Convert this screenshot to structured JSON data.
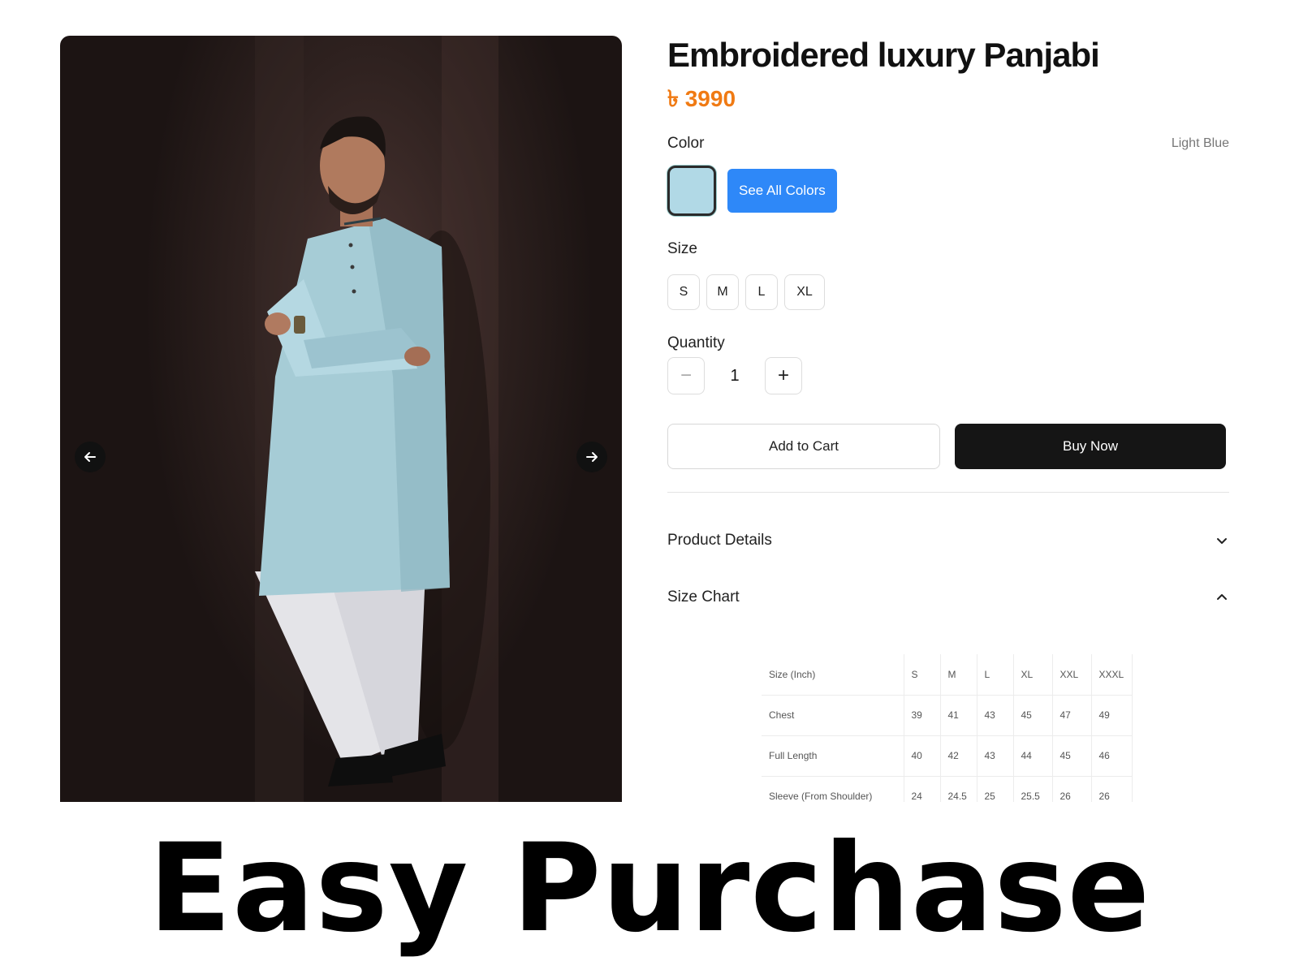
{
  "product": {
    "title": "Embroidered luxury Panjabi",
    "price": "৳ 3990",
    "price_color": "#f07a13"
  },
  "color": {
    "label": "Color",
    "selected_name": "Light Blue",
    "swatch_hex": "#b1d9e6",
    "see_all_label": "See All Colors",
    "see_all_color": "#2e88f8"
  },
  "size": {
    "label": "Size",
    "options": [
      "S",
      "M",
      "L",
      "XL"
    ]
  },
  "quantity": {
    "label": "Quantity",
    "value": "1",
    "decrement_symbol": "−",
    "increment_symbol": "+"
  },
  "actions": {
    "add_to_cart": "Add to Cart",
    "buy_now": "Buy Now"
  },
  "accordions": {
    "product_details": "Product Details",
    "size_chart": "Size Chart"
  },
  "size_chart": {
    "headers": [
      "Size (Inch)",
      "S",
      "M",
      "L",
      "XL",
      "XXL",
      "XXXL"
    ],
    "rows": [
      [
        "Chest",
        "39",
        "41",
        "43",
        "45",
        "47",
        "49"
      ],
      [
        "Full Length",
        "40",
        "42",
        "43",
        "44",
        "45",
        "46"
      ],
      [
        "Sleeve (From Shoulder)",
        "24",
        "24.5",
        "25",
        "25.5",
        "26",
        "26"
      ]
    ]
  },
  "gallery": {
    "prev_icon": "arrow-left-icon",
    "next_icon": "arrow-right-icon"
  },
  "banner": {
    "text": "Easy Purchase"
  }
}
